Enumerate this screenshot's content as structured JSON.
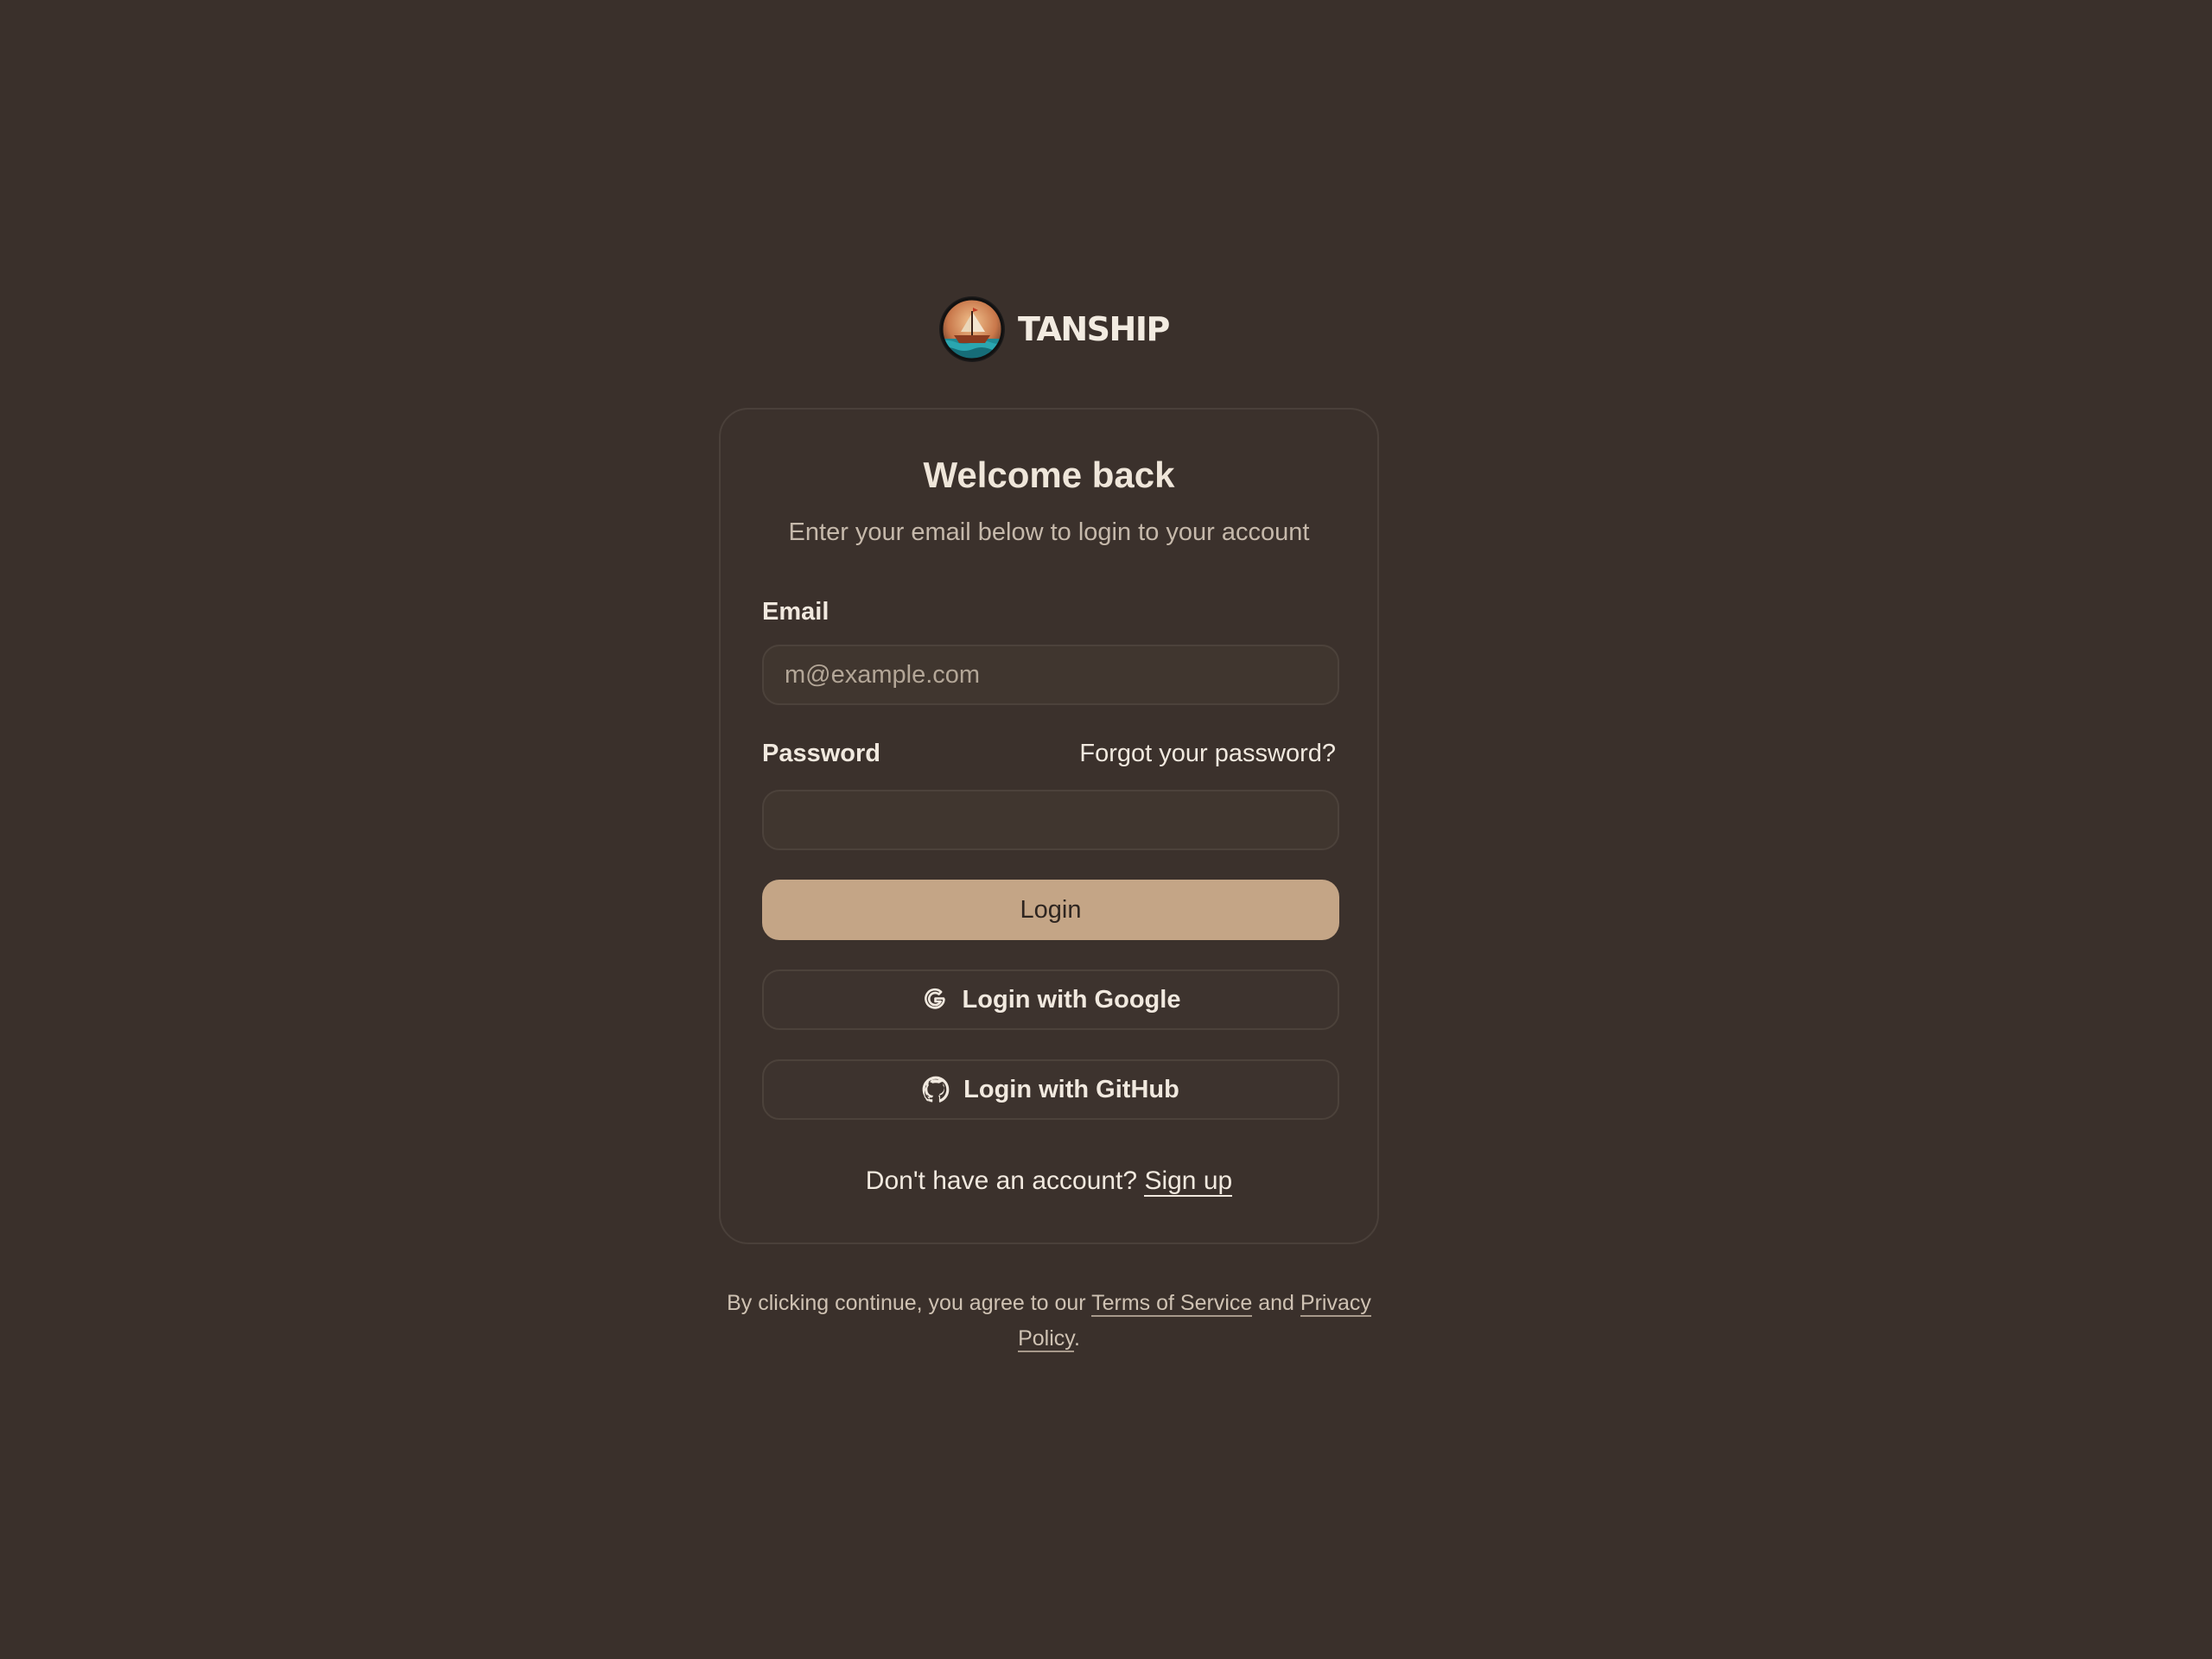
{
  "brand": {
    "name": "TANSHIP",
    "logo_icon": "ship-logo-icon"
  },
  "card": {
    "title": "Welcome back",
    "subtitle": "Enter your email below to login to your account"
  },
  "form": {
    "email_label": "Email",
    "email_placeholder": "m@example.com",
    "email_value": "",
    "password_label": "Password",
    "password_value": "",
    "forgot_link": "Forgot your password?",
    "login_button": "Login",
    "google_button": "Login with Google",
    "google_icon": "google-icon",
    "github_button": "Login with GitHub",
    "github_icon": "github-icon"
  },
  "signup": {
    "prompt": "Don't have an account?",
    "link": "Sign up"
  },
  "legal": {
    "prefix": "By clicking continue, you agree to our",
    "terms": "Terms of Service",
    "and": "and",
    "privacy": "Privacy Policy",
    "suffix": "."
  },
  "colors": {
    "background": "#3a302b",
    "card_border": "#4a403a",
    "primary_button": "#c4a586",
    "text": "#efe6da",
    "muted_text": "#c6b9ab"
  }
}
